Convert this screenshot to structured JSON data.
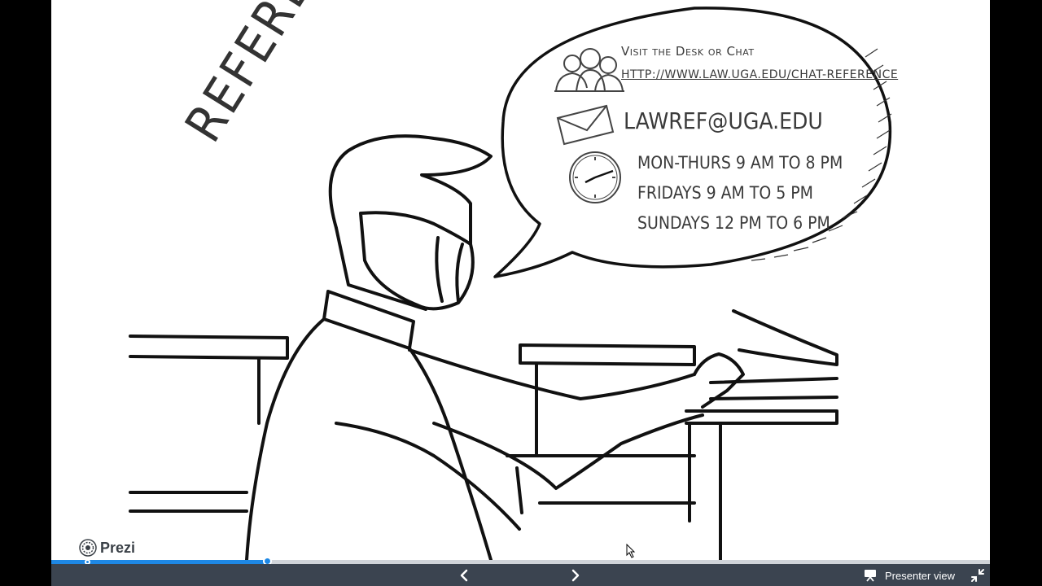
{
  "slide": {
    "title": "REFERENCE",
    "bubble": {
      "visit_label": "Visit the Desk or Chat",
      "url": "http://www.law.uga.edu/chat-reference",
      "email": "lawref@uga.edu",
      "hours": [
        "MON-THURS 9 AM to 8 PM",
        "FRIDAYS 9 AM to 5 PM",
        "SUNDAYS 12 PM to 6 PM"
      ]
    }
  },
  "player": {
    "brand": "Prezi",
    "progress_fraction": 0.23,
    "presenter_label": "Presenter view",
    "icons": {
      "prev": "chevron-left-icon",
      "next": "chevron-right-icon",
      "presenter": "presenter-screen-icon",
      "fullscreen": "fullscreen-collapse-icon",
      "logo": "prezi-logo-icon"
    },
    "colors": {
      "accent": "#1e88e5",
      "toolbar": "#3b4450",
      "track": "#d0d4d9"
    }
  }
}
